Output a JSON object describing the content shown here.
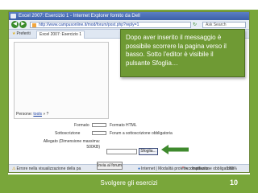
{
  "browser": {
    "window_title": "Excel 2007: Esercizio 1 - Internet Explorer fornito da Dell",
    "address": "http://www.campusonline.it/mod/forum/post.php?reply=1",
    "search_placeholder": "Ask Search",
    "favorites_label": "Preferiti",
    "tab_label": "Excel 2007: Esercizio 1",
    "nav_back": "◀",
    "nav_forward": "▶",
    "go_icon": "↻"
  },
  "tooltip": {
    "text": "Dopo aver inserito il messaggio è possibile scorrere la pagina verso il basso. Sotto l'editor è visibile il pulsante Sfoglia…"
  },
  "form": {
    "persone_label": "Persone:",
    "persone_link": "tools",
    "persone_suffix": "» ?",
    "format_label": "Formato",
    "format_value": "Formato HTML",
    "subscription_label": "Sottoscrizione",
    "subscription_value": "Forum a sottoscrizione obbligatoria",
    "attachment_label": "Allegato (Dimensione massima: 500KB)",
    "browse_button": "Sfoglia...",
    "submit_button": "Invia al forum",
    "required_note": "= compilazione obbligatoria",
    "required_mark": "*"
  },
  "status_bar": {
    "left": "Errore nella visualizzazione della pa",
    "right": "Internet | Modalità protetta: disattivata",
    "zoom": "100%"
  },
  "footer": {
    "title": "Svolgere gli esercizi",
    "page": "10"
  },
  "colors": {
    "frame_green": "#79a63a",
    "tooltip_green": "#6f9a34",
    "arrow_green": "#3f8a2e"
  }
}
